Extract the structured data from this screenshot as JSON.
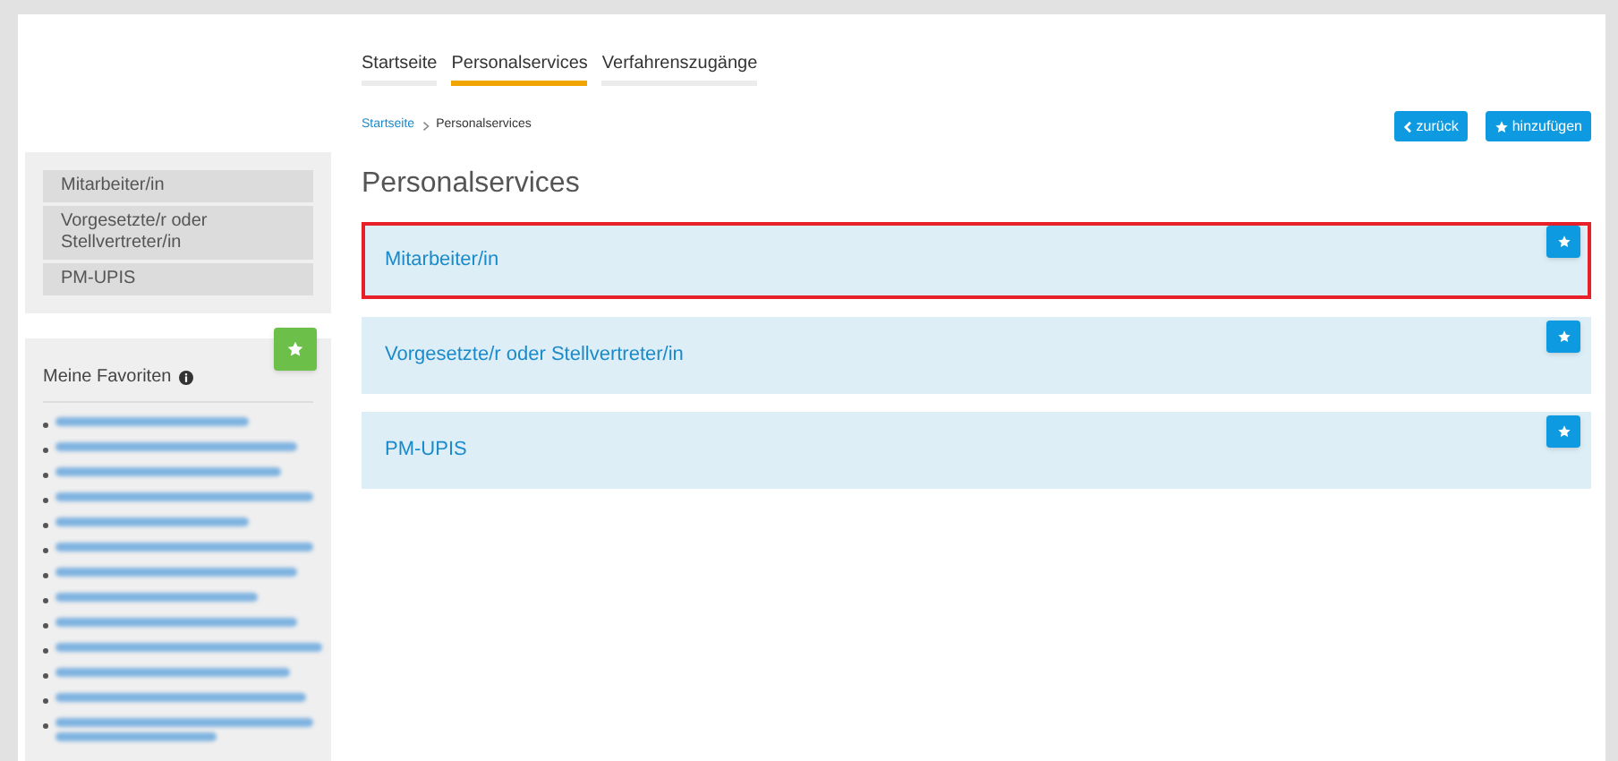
{
  "nav_tabs": [
    {
      "label": "Startseite",
      "selected": false
    },
    {
      "label": "Personalservices",
      "selected": true
    },
    {
      "label": "Verfahrenszugänge",
      "selected": false
    }
  ],
  "breadcrumb": [
    "Startseite",
    "Personalservices"
  ],
  "buttons": {
    "back": "zurück",
    "add": "hinzufügen"
  },
  "sidebar": {
    "items": [
      "Mitarbeiter/in",
      "Vorgesetzte/r oder Stellvertreter/in",
      "PM-UPIS"
    ]
  },
  "favorites": {
    "title": "Meine Favoriten"
  },
  "page_title": "Personalservices",
  "cards": [
    {
      "label": "Mitarbeiter/in",
      "selected": true
    },
    {
      "label": "Vorgesetzte/r oder Stellvertreter/in",
      "selected": false
    },
    {
      "label": "PM-UPIS",
      "selected": false
    }
  ]
}
